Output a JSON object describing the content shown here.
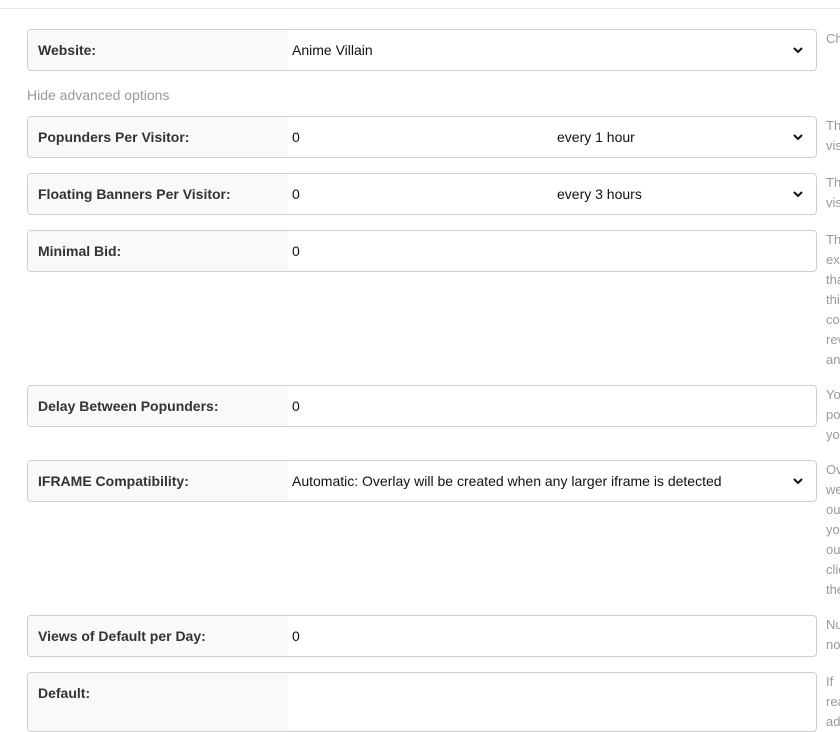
{
  "website": {
    "label": "Website:",
    "value": "Anime Villain",
    "help": [
      "Ch"
    ]
  },
  "advanced_toggle": "Hide advanced options",
  "popunders": {
    "label": "Popunders Per Visitor:",
    "value": "0",
    "frequency": "every 1 hour",
    "help": [
      "Th",
      "vis"
    ]
  },
  "floating_banners": {
    "label": "Floating Banners Per Visitor:",
    "value": "0",
    "frequency": "every 3 hours",
    "help": [
      "Th",
      "vis"
    ]
  },
  "minimal_bid": {
    "label": "Minimal Bid:",
    "value": "0",
    "help": [
      "Th",
      "ex",
      "tha",
      "thi",
      "co",
      "rev",
      "an"
    ]
  },
  "delay": {
    "label": "Delay Between Popunders:",
    "value": "0",
    "help": [
      "Yo",
      "po",
      "yo"
    ]
  },
  "iframe": {
    "label": "IFRAME Compatibility:",
    "value": "Automatic: Overlay will be created when any larger iframe is detected",
    "help": [
      "Ov",
      "we",
      "ou",
      "yo",
      "ou",
      "clic",
      "the"
    ]
  },
  "views_default": {
    "label": "Views of Default per Day:",
    "value": "0",
    "help": [
      "Nu",
      "no"
    ]
  },
  "default": {
    "label": "Default:",
    "help": [
      "If",
      "rea",
      "ad"
    ]
  }
}
